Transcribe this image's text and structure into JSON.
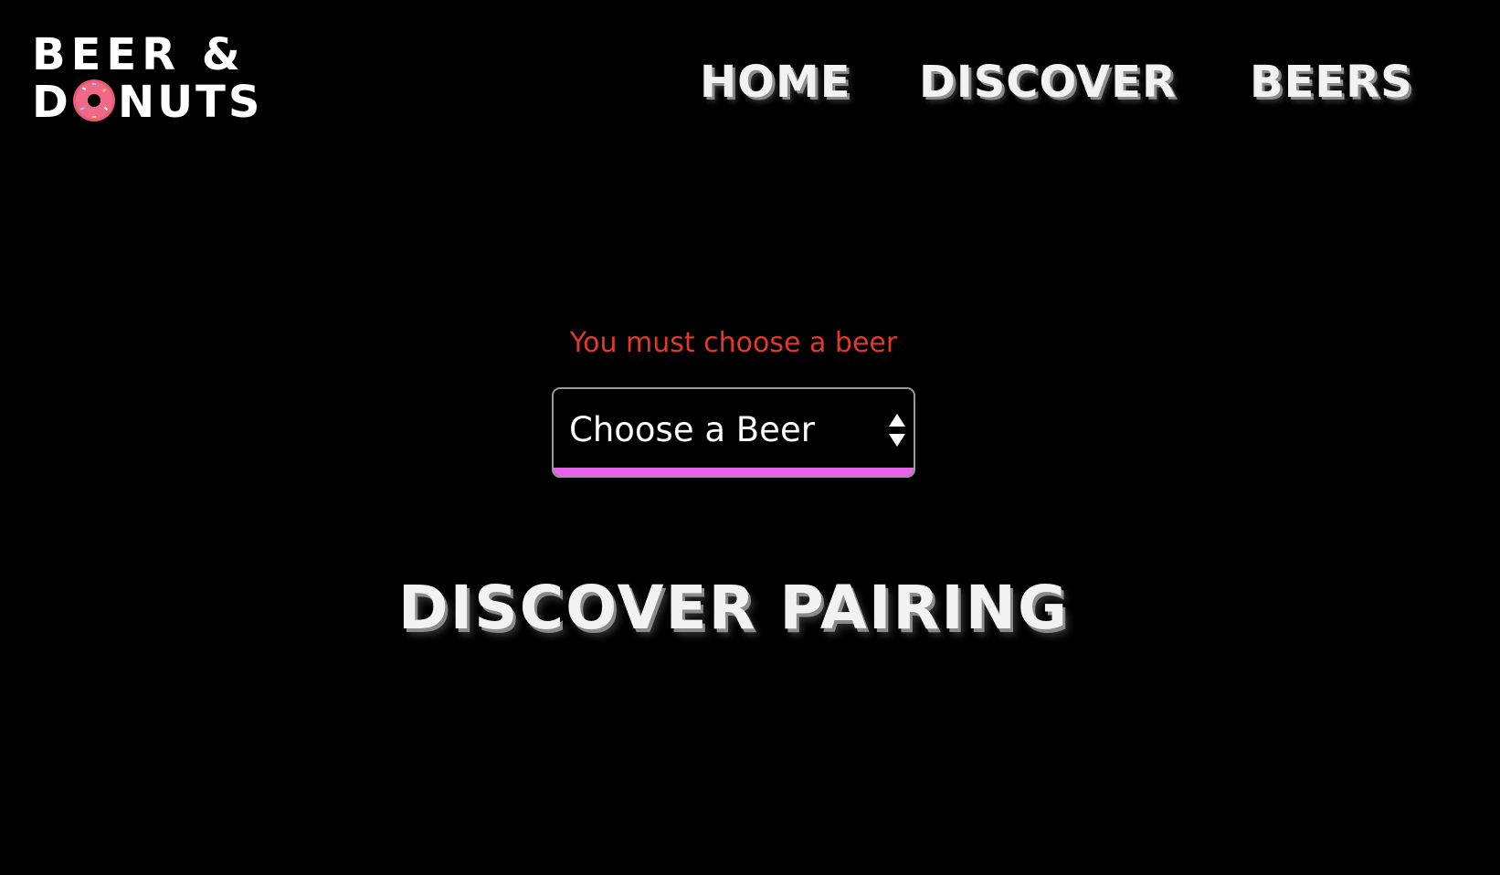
{
  "brand": {
    "line1": "BEER &",
    "line2_prefix": "D",
    "line2_suffix": "NUTS",
    "donut_icon": "donut-icon",
    "text_color": "#ffffff",
    "donut_color": "#e85a78"
  },
  "nav": {
    "home": "HOME",
    "discover": "DISCOVER",
    "beers": "BEERS"
  },
  "form": {
    "error": "You must choose a beer",
    "error_color": "#e03a2c",
    "select_value": "Choose a Beer",
    "select_icon": "up-down-arrows-icon",
    "accent_color": "#e564e7"
  },
  "main": {
    "title": "DISCOVER PAIRING"
  }
}
